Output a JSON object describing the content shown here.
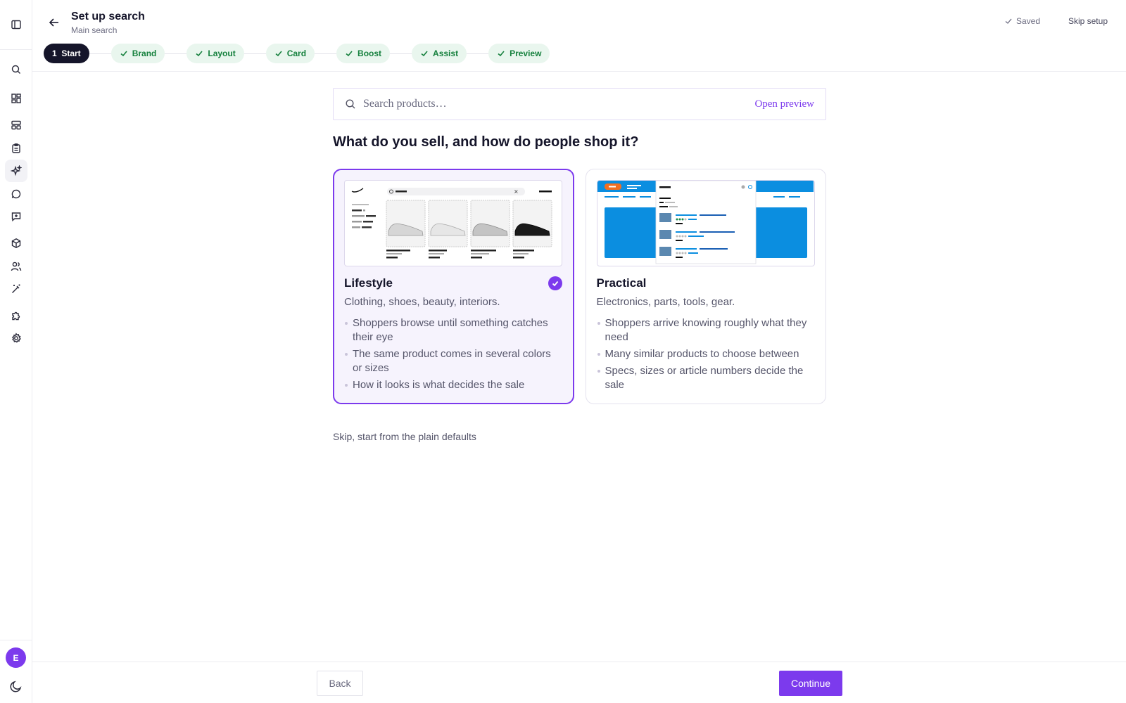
{
  "header": {
    "title": "Set up search",
    "subtitle": "Main search",
    "saved_label": "Saved",
    "skip_label": "Skip setup"
  },
  "steps": [
    {
      "label": "1  Start",
      "state": "current"
    },
    {
      "label": "Brand",
      "state": "done"
    },
    {
      "label": "Layout",
      "state": "done"
    },
    {
      "label": "Card",
      "state": "done"
    },
    {
      "label": "Boost",
      "state": "done"
    },
    {
      "label": "Assist",
      "state": "done"
    },
    {
      "label": "Preview",
      "state": "done"
    }
  ],
  "sidebar": {
    "items": [
      {
        "icon": "search-icon"
      },
      {
        "icon": "dashboard-icon"
      },
      {
        "icon": "layout-icon"
      },
      {
        "icon": "clipboard-icon"
      },
      {
        "icon": "sparkles-icon",
        "active": true
      },
      {
        "icon": "chat-icon"
      },
      {
        "icon": "message-plus-icon"
      },
      {
        "icon": "box-icon"
      },
      {
        "icon": "users-icon"
      },
      {
        "icon": "magic-wand-icon"
      },
      {
        "icon": "puzzle-icon"
      },
      {
        "icon": "gear-icon"
      }
    ],
    "avatar_initial": "E"
  },
  "search": {
    "placeholder": "Search products…",
    "link": "Open preview"
  },
  "question": "What do you sell, and how do people shop it?",
  "options": [
    {
      "title": "Lifestyle",
      "description": "Clothing, shoes, beauty, interiors.",
      "bullets": [
        "Shoppers browse until something catches their eye",
        "The same product comes in several colors or sizes",
        "How it looks is what decides the sale"
      ],
      "selected": true
    },
    {
      "title": "Practical",
      "description": "Electronics, parts, tools, gear.",
      "bullets": [
        "Shoppers arrive knowing roughly what they need",
        "Many similar products to choose between",
        "Specs, sizes or article numbers decide the sale"
      ],
      "selected": false
    }
  ],
  "skip_defaults": "Skip, start from the plain defaults",
  "footer": {
    "back_label": "Back",
    "continue_label": "Continue"
  },
  "colors": {
    "accent": "#7c3aed",
    "step_done_bg": "#e9f6ee",
    "step_done_text": "#15803d",
    "practical_blue": "#0b8ee0"
  }
}
